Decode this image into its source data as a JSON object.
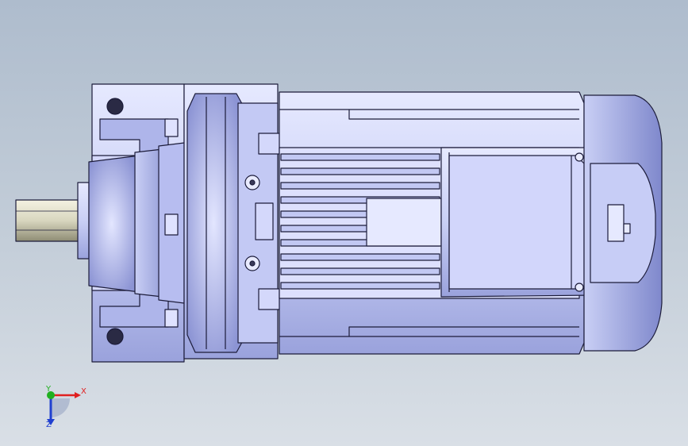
{
  "colors": {
    "background_top": "#aebccd",
    "background_bottom": "#d9dfe6",
    "body": "#c9cff5",
    "body_shade": "#8f97d6",
    "outline": "#1c1c3a",
    "shaft": "#d8d6bf",
    "x_axis": "#e02020",
    "y_axis": "#20b020",
    "z_axis": "#2040d0"
  },
  "triad": {
    "x_label": "X",
    "y_label": "Y",
    "z_label": "Z"
  }
}
